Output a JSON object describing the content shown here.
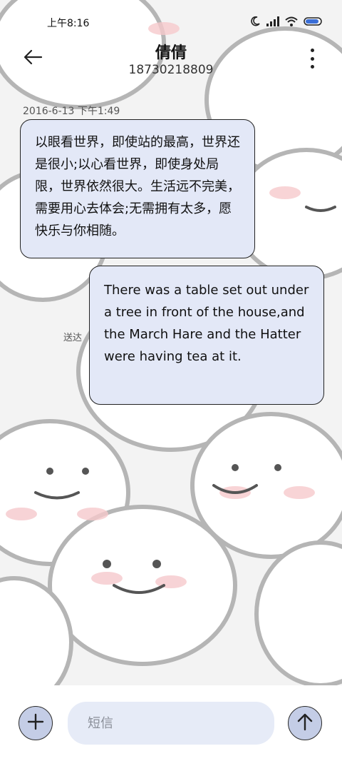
{
  "status_bar": {
    "time": "上午8:16",
    "icons": [
      "moon-icon",
      "signal-icon",
      "wifi-icon",
      "battery-icon"
    ]
  },
  "header": {
    "contact_name": "倩倩",
    "phone_number": "18730218809",
    "back_icon": "back-arrow-icon",
    "more_icon": "more-vertical-icon"
  },
  "conversation": {
    "timestamp": "2016-6-13 下午1:49",
    "messages": [
      {
        "direction": "incoming",
        "text": "以眼看世界，即使站的最高，世界还是很小;以心看世界，即使身处局限，世界依然很大。生活远不完美，需要用心去体会;无需拥有太多，愿快乐与你相随。"
      },
      {
        "direction": "outgoing",
        "text": "There was a table set out under a tree in front of the house,and the March Hare and the Hatter were having tea at it.",
        "status": "送达"
      }
    ]
  },
  "composer": {
    "placeholder": "短信",
    "add_icon": "plus-icon",
    "send_icon": "send-arrow-up-icon"
  },
  "colors": {
    "bubble_bg": "#e3e8f7",
    "button_bg": "#c4cde6",
    "input_bg": "#e6ebf7"
  }
}
